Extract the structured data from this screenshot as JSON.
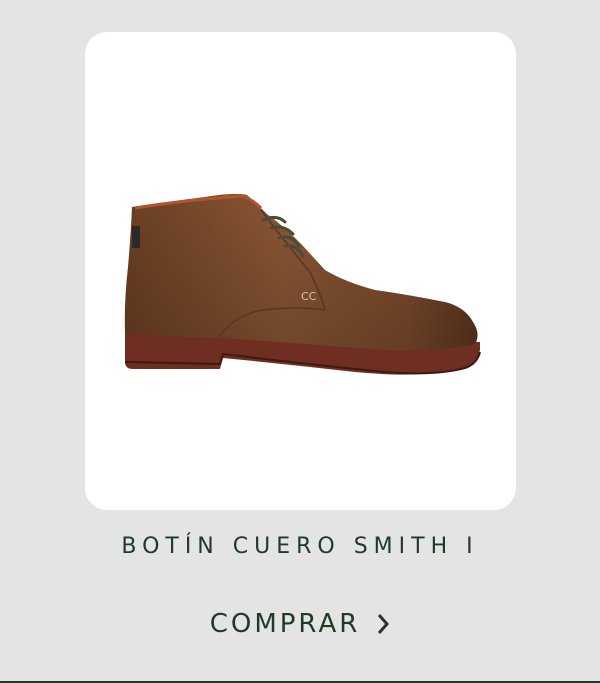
{
  "product": {
    "name": "BOTÍN CUERO SMITH I",
    "image_alt": "Botín de cuero marrón"
  },
  "cta": {
    "label": "COMPRAR",
    "icon": "chevron-right-icon"
  },
  "colors": {
    "background": "#e4e4e4",
    "card": "#ffffff",
    "text": "#1f3a27",
    "leather": "#7a4a2b"
  }
}
